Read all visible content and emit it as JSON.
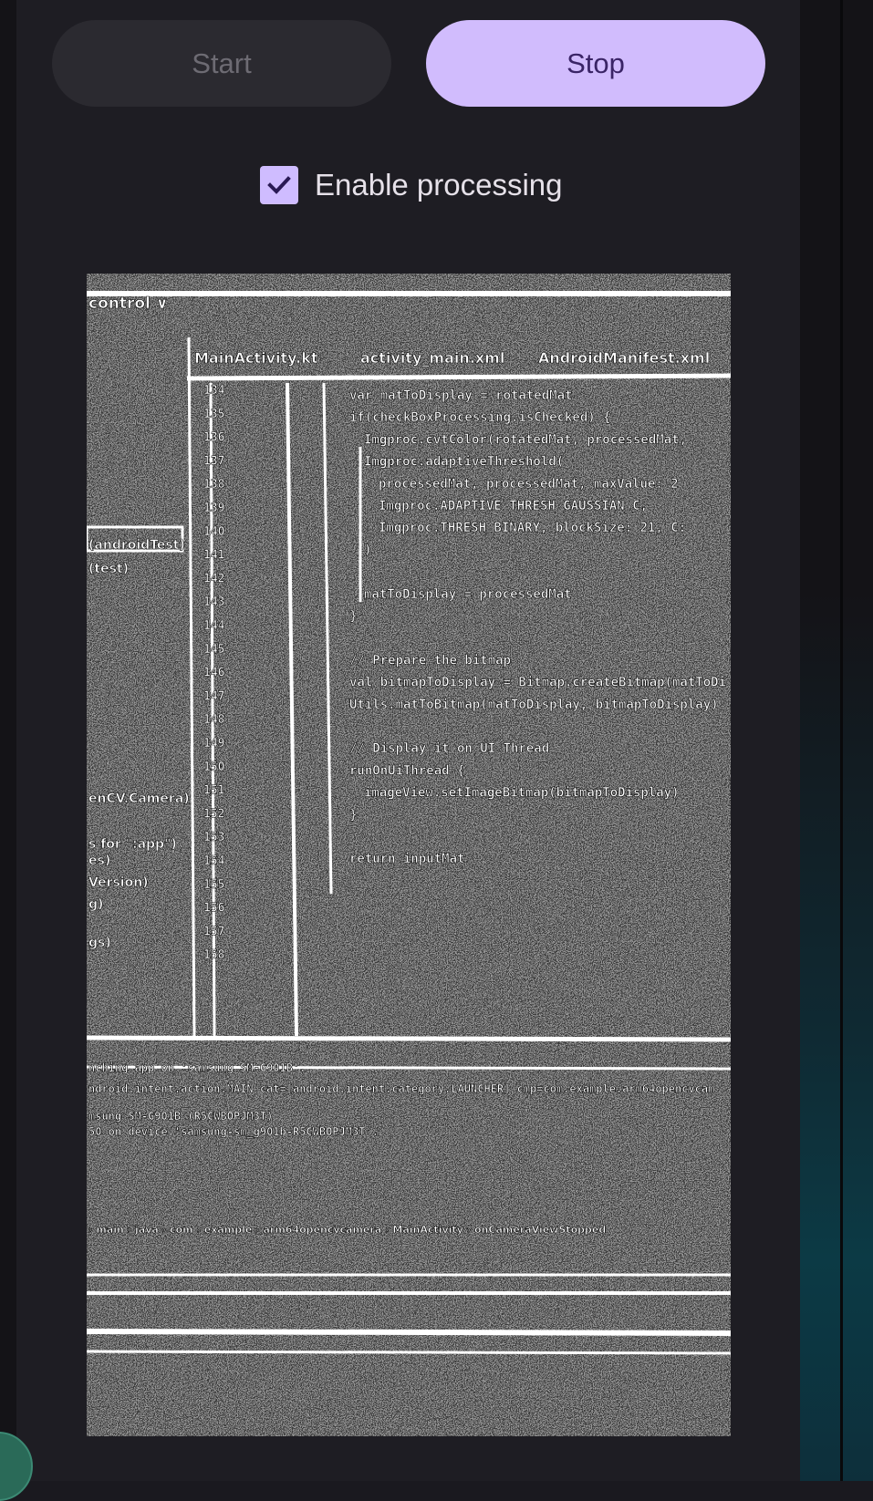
{
  "controls": {
    "start_label": "Start",
    "stop_label": "Stop",
    "checkbox_label": "Enable processing",
    "checkbox_checked": true
  },
  "preview": {
    "ide_text": {
      "header": "control ∨",
      "tabs": [
        "MainActivity.kt",
        "activity_main.xml",
        "AndroidManifest.xml"
      ],
      "sidebar": [
        "(androidTest)",
        "(test)",
        "enCV.Camera)",
        "s for \":app\")",
        "es)",
        "Version)",
        "g)",
        "gs)"
      ],
      "line_numbers": [
        "134",
        "135",
        "136",
        "137",
        "138",
        "139",
        "140",
        "141",
        "142",
        "143",
        "144",
        "145",
        "146",
        "147",
        "148",
        "149",
        "150",
        "151",
        "152",
        "153",
        "154",
        "155",
        "156",
        "157",
        "158"
      ],
      "code_lines": [
        "var matToDisplay = rotatedMat",
        "if(checkBoxProcessing.isChecked) {",
        "    Imgproc.cvtColor(rotatedMat, processedMat,",
        "    Imgproc.adaptiveThreshold(",
        "        processedMat, processedMat, maxValue: 2",
        "        Imgproc.ADAPTIVE_THRESH_GAUSSIAN_C,",
        "        Imgproc.THRESH_BINARY, blockSize: 21, C:",
        "    )",
        "",
        "    matToDisplay = processedMat",
        "}",
        "",
        "// Prepare the bitmap",
        "val bitmapToDisplay = Bitmap.createBitmap(matToDi",
        "Utils.matToBitmap(matToDisplay, bitmapToDisplay)",
        "",
        "// Display it on UI Thread",
        "runOnUiThread {",
        "    imageView.setImageBitmap(bitmapToDisplay)",
        "}",
        "",
        "return inputMat"
      ],
      "console_lines": [
        "nching app on 'samsung SM-G901B'.",
        "ndroid.intent.action.MAIN cat=[android.intent.category.LAUNCHER] cmp=com.example.arm64opencvcam",
        "",
        "msung SM-G901B (R5CWBOPJM3T)",
        "50 on device 'samsung-sm_g901b-R5CWBOPJM3T'."
      ],
      "breadcrumb": "› main › java › com › example › arm64opencvcamera › MainActivity › onCameraViewStopped"
    }
  },
  "colors": {
    "background": "#1a191f",
    "stop_button": "#d1bcfd",
    "start_button": "#2b2a30",
    "checkbox": "#cfbcff"
  }
}
